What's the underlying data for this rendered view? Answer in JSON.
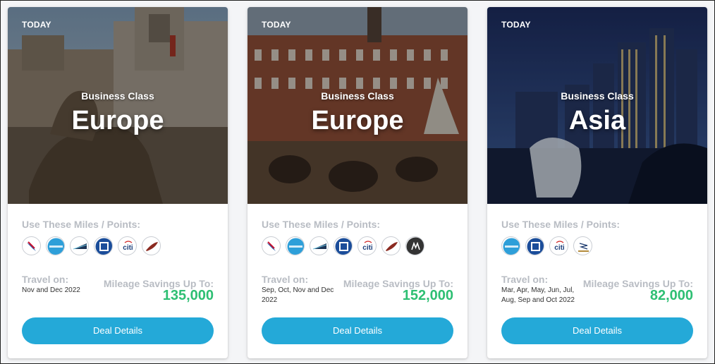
{
  "cards": [
    {
      "badge": "TODAY",
      "class_label": "Business Class",
      "destination": "Europe",
      "miles_label": "Use These Miles / Points:",
      "logos": [
        "american-airlines-icon",
        "amex-icon",
        "alaska-airlines-icon",
        "chase-icon",
        "citi-icon",
        "virgin-icon"
      ],
      "travel_label": "Travel on:",
      "travel_dates": "Nov and Dec 2022",
      "savings_label": "Mileage Savings Up To:",
      "savings_value": "135,000",
      "button_label": "Deal Details"
    },
    {
      "badge": "TODAY",
      "class_label": "Business Class",
      "destination": "Europe",
      "miles_label": "Use These Miles / Points:",
      "logos": [
        "american-airlines-icon",
        "amex-icon",
        "alaska-airlines-icon",
        "chase-icon",
        "citi-icon",
        "virgin-icon",
        "marriott-icon"
      ],
      "travel_label": "Travel on:",
      "travel_dates": "Sep, Oct, Nov and Dec 2022",
      "savings_label": "Mileage Savings Up To:",
      "savings_value": "152,000",
      "button_label": "Deal Details"
    },
    {
      "badge": "TODAY",
      "class_label": "Business Class",
      "destination": "Asia",
      "miles_label": "Use These Miles / Points:",
      "logos": [
        "amex-icon",
        "chase-icon",
        "citi-icon",
        "singapore-airlines-icon"
      ],
      "travel_label": "Travel on:",
      "travel_dates": "Mar, Apr, May, Jun, Jul, Aug, Sep and Oct 2022",
      "savings_label": "Mileage Savings Up To:",
      "savings_value": "82,000",
      "button_label": "Deal Details"
    }
  ],
  "colors": {
    "accent": "#24a9d8",
    "savings": "#2ebf73",
    "muted_label": "#b8bcc3"
  }
}
